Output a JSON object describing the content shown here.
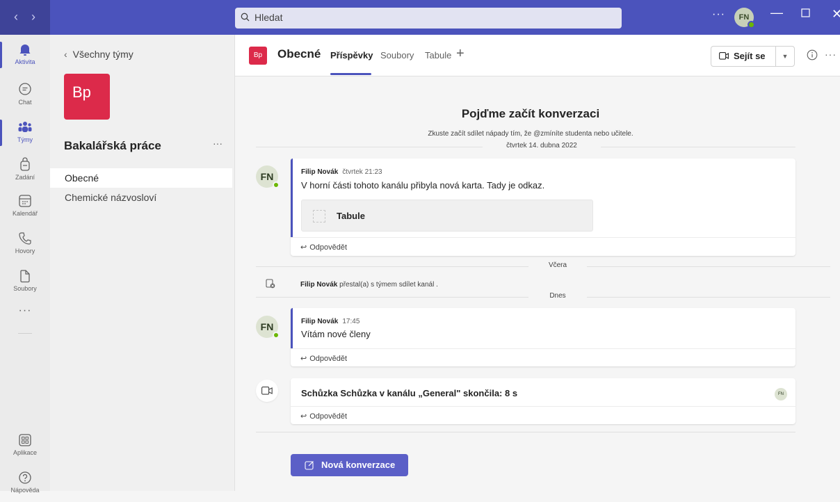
{
  "titlebar": {
    "search_placeholder": "Hledat",
    "more": "···",
    "avatar_initials": "FN"
  },
  "rail": {
    "items": [
      {
        "label": "Aktivita",
        "icon": "bell-icon"
      },
      {
        "label": "Chat",
        "icon": "chat-icon"
      },
      {
        "label": "Týmy",
        "icon": "teams-icon"
      },
      {
        "label": "Zadání",
        "icon": "assignments-icon"
      },
      {
        "label": "Kalendář",
        "icon": "calendar-icon"
      },
      {
        "label": "Hovory",
        "icon": "phone-icon"
      },
      {
        "label": "Soubory",
        "icon": "file-icon"
      }
    ],
    "more": "···",
    "apps_label": "Aplikace",
    "help_label": "Nápověda"
  },
  "teampanel": {
    "back_label": "Všechny týmy",
    "team_initials": "Bp",
    "team_name": "Bakalářská práce",
    "more": "···",
    "channels": [
      "Obecné",
      "Chemické názvosloví"
    ]
  },
  "channel": {
    "initials": "Bp",
    "name": "Obecné",
    "tabs": [
      "Příspěvky",
      "Soubory",
      "Tabule"
    ],
    "add_tab": "+",
    "meet_label": "Sejít se",
    "more": "···"
  },
  "feed": {
    "empty_title": "Pojďme začít konverzaci",
    "empty_sub": "Zkuste začít sdílet nápady tím, že @zmíníte studenta nebo učitele.",
    "date1": "čtvrtek 14. dubna 2022",
    "post1": {
      "avatar": "FN",
      "author": "Filip Novák",
      "time": "čtvrtek 21:23",
      "text": "V horní části tohoto kanálu přibyla nová karta. Tady je odkaz.",
      "card_title": "Tabule",
      "reply": "Odpovědět"
    },
    "date2": "Včera",
    "system": {
      "author": "Filip Novák",
      "text": "přestal(a) s týmem sdílet kanál ."
    },
    "date3": "Dnes",
    "post2": {
      "avatar": "FN",
      "author": "Filip Novák",
      "time": "17:45",
      "text": "Vítám nové členy",
      "reply": "Odpovědět"
    },
    "meeting": {
      "text": "Schůzka Schůzka v kanálu „General\" skončila: 8 s",
      "avatar": "FN",
      "reply": "Odpovědět"
    },
    "new_conversation": "Nová konverzace"
  },
  "colors": {
    "brand": "#4b53bc",
    "team_tile": "#dc2a4a",
    "presence": "#6bb700"
  }
}
